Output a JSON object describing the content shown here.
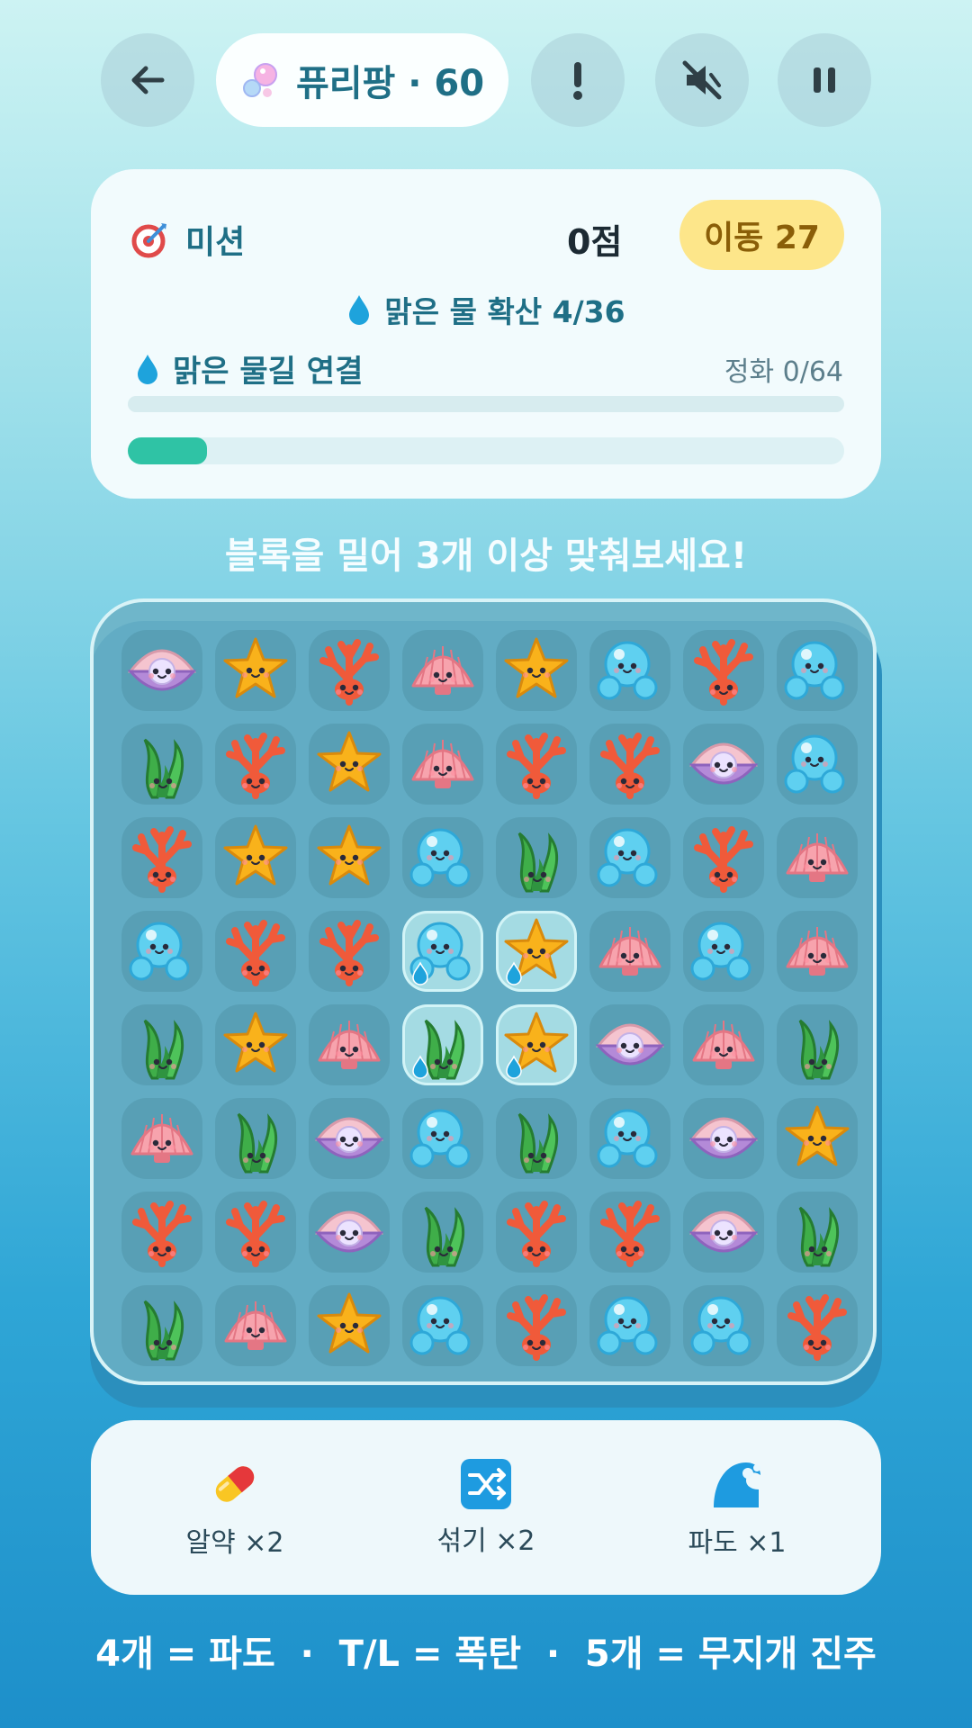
{
  "header": {
    "title": "퓨리팡 · 60"
  },
  "mission": {
    "label": "미션",
    "score": "0점",
    "moves": "이동 27",
    "goal1": "맑은 물 확산 4/36",
    "goal2": "맑은 물길 연결",
    "purify": "정화 0/64",
    "bar1_progress": 0.0,
    "bar2_progress": 0.11
  },
  "hint": "블록을 밀어 3개 이상 맞춰보세요!",
  "board": {
    "rows": [
      [
        "pearl-clam",
        "starfish",
        "coral",
        "shell",
        "starfish",
        "bubble",
        "coral",
        "bubble"
      ],
      [
        "seaweed",
        "coral",
        "starfish",
        "shell",
        "coral",
        "coral",
        "pearl-clam",
        "bubble"
      ],
      [
        "coral",
        "starfish",
        "starfish",
        "bubble",
        "seaweed",
        "bubble",
        "coral",
        "shell"
      ],
      [
        "bubble",
        "coral",
        "coral",
        "bubble",
        "starfish",
        "shell",
        "bubble",
        "shell"
      ],
      [
        "seaweed",
        "starfish",
        "shell",
        "seaweed",
        "starfish",
        "pearl-clam",
        "shell",
        "seaweed"
      ],
      [
        "shell",
        "seaweed",
        "pearl-clam",
        "bubble",
        "seaweed",
        "bubble",
        "pearl-clam",
        "starfish"
      ],
      [
        "coral",
        "coral",
        "pearl-clam",
        "seaweed",
        "coral",
        "coral",
        "pearl-clam",
        "seaweed"
      ],
      [
        "seaweed",
        "shell",
        "starfish",
        "bubble",
        "coral",
        "bubble",
        "bubble",
        "coral"
      ]
    ],
    "clear_water_tiles": [
      [
        3,
        3
      ],
      [
        3,
        4
      ],
      [
        4,
        3
      ],
      [
        4,
        4
      ]
    ]
  },
  "items": [
    {
      "icon": "pill-icon",
      "label": "알약 ×2"
    },
    {
      "icon": "shuffle-icon",
      "label": "섞기 ×2"
    },
    {
      "icon": "wave-icon",
      "label": "파도 ×1"
    }
  ],
  "footer": "4개 = 파도  ·  T/L = 폭탄  ·  5개 = 무지개 진주",
  "colors": {
    "accent": "#2fc3a5",
    "moves_bg": "#fde68a",
    "title": "#1f6f86"
  }
}
